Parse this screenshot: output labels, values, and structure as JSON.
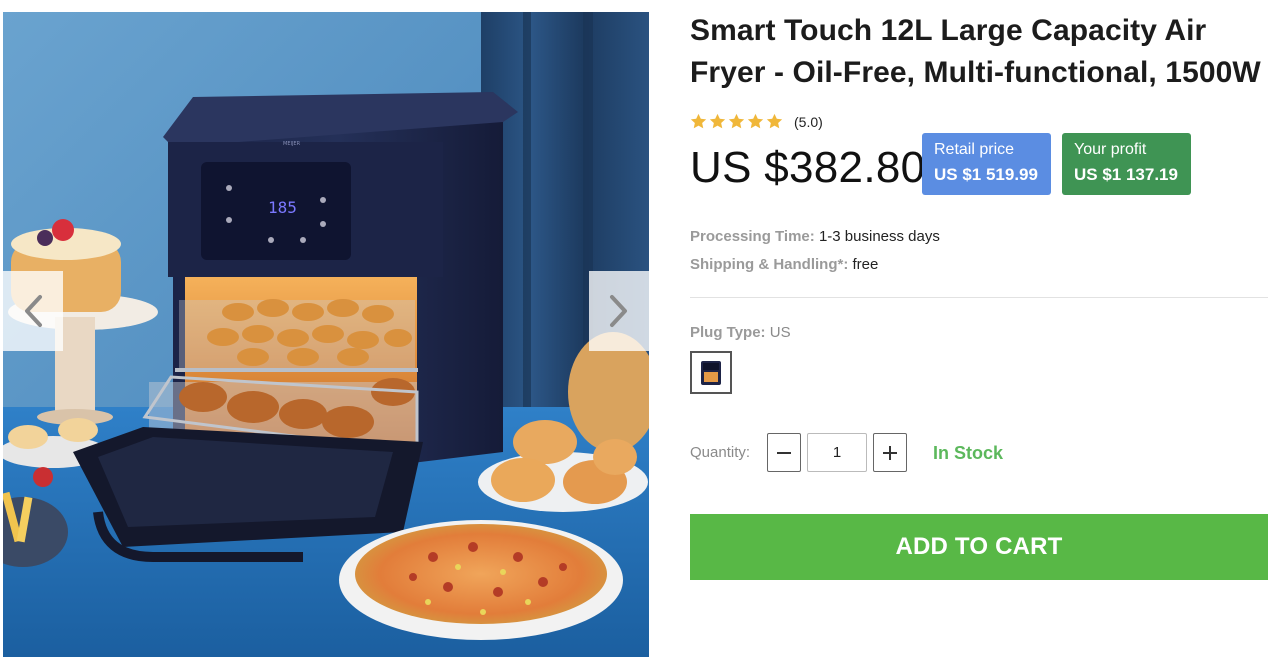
{
  "product": {
    "title": "Smart Touch 12L Large Capacity Air Fryer - Oil-Free, Multi-functional, 1500W",
    "rating": {
      "stars": 5,
      "max": 5,
      "value_text": "(5.0)",
      "star_color": "#f0b73a"
    },
    "price": "US $382.80",
    "retail": {
      "label": "Retail price",
      "value": "US $1 519.99",
      "color": "#5b8de2"
    },
    "profit": {
      "label": "Your profit",
      "value": "US $1 137.19",
      "color": "#3f9454"
    },
    "processing": {
      "label": "Processing Time:",
      "value": "1-3 business days"
    },
    "shipping": {
      "label": "Shipping & Handling*:",
      "value": "free"
    },
    "plug": {
      "label": "Plug Type:",
      "value": "US"
    },
    "quantity": {
      "label": "Quantity:",
      "value": "1"
    },
    "stock": "In Stock",
    "cart_button": "ADD TO CART"
  },
  "gallery": {
    "display_reading": "185",
    "brand_mark": "MEIJER",
    "prev_icon": "chevron-left-icon",
    "next_icon": "chevron-right-icon"
  },
  "colors": {
    "accent_green": "#58b846",
    "stock_green": "#5cb85c"
  }
}
